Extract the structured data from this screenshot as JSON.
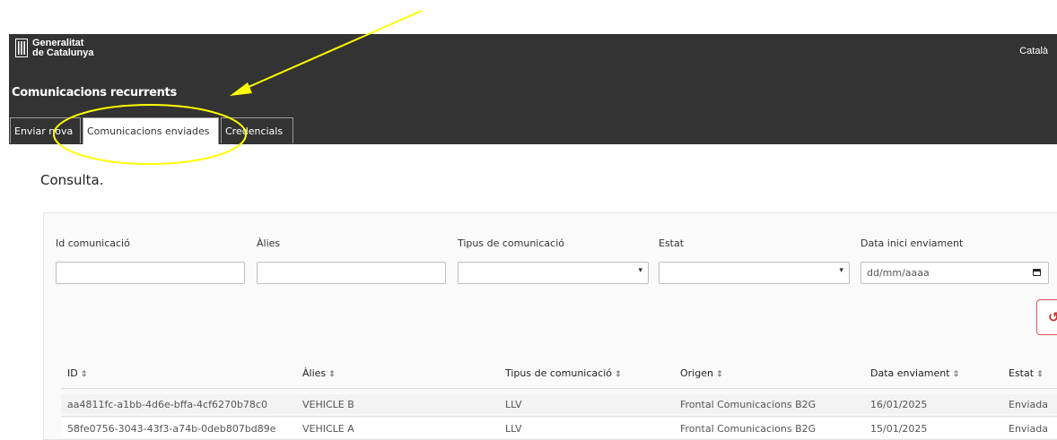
{
  "header": {
    "logo_line1": "Generalitat",
    "logo_line2": "de Catalunya",
    "language": "Català",
    "app_title": "Comunicacions recurrents"
  },
  "tabs": [
    {
      "label": "Enviar nova",
      "active": false
    },
    {
      "label": "Comunicacions enviades",
      "active": true
    },
    {
      "label": "Credencials",
      "active": false
    }
  ],
  "page_heading": "Consulta.",
  "filters": {
    "id_label": "Id comunicació",
    "alies_label": "Àlies",
    "tipus_label": "Tipus de comunicació",
    "estat_label": "Estat",
    "data_label": "Data inici enviament",
    "date_placeholder": "dd/mm/aaaa"
  },
  "table": {
    "headers": [
      "ID",
      "Àlies",
      "Tipus de comunicació",
      "Origen",
      "Data enviament",
      "Estat"
    ],
    "sort_glyph": "⇕",
    "rows": [
      [
        "aa4811fc-a1bb-4d6e-bffa-4cf6270b78c0",
        "VEHICLE B",
        "LLV",
        "Frontal Comunicacions B2G",
        "16/01/2025",
        "Enviada"
      ],
      [
        "58fe0756-3043-43f3-a74b-0deb807bd89e",
        "VEHICLE A",
        "LLV",
        "Frontal Comunicacions B2G",
        "15/01/2025",
        "Enviada"
      ]
    ]
  },
  "colors": {
    "header_bg": "#333333",
    "annotation": "#ffff00",
    "reset": "#d9534f"
  },
  "icons": {
    "reset": "undo-icon",
    "date": "calendar-icon",
    "select": "chevron-down-icon"
  }
}
